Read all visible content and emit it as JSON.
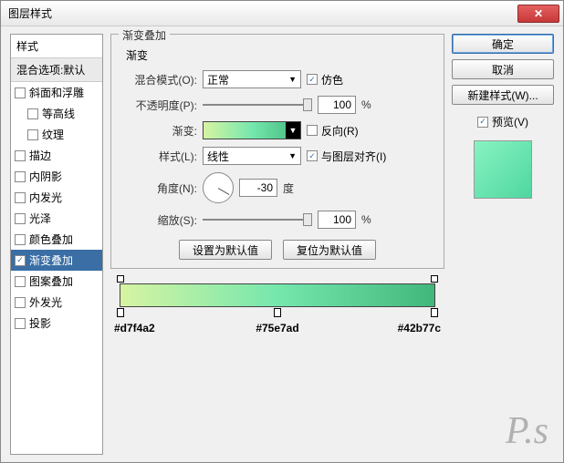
{
  "window": {
    "title": "图层样式"
  },
  "styles": {
    "header": "样式",
    "sub": "混合选项:默认",
    "items": [
      {
        "label": "斜面和浮雕",
        "checked": false,
        "indent": false,
        "selected": false
      },
      {
        "label": "等高线",
        "checked": false,
        "indent": true,
        "selected": false
      },
      {
        "label": "纹理",
        "checked": false,
        "indent": true,
        "selected": false
      },
      {
        "label": "描边",
        "checked": false,
        "indent": false,
        "selected": false
      },
      {
        "label": "内阴影",
        "checked": false,
        "indent": false,
        "selected": false
      },
      {
        "label": "内发光",
        "checked": false,
        "indent": false,
        "selected": false
      },
      {
        "label": "光泽",
        "checked": false,
        "indent": false,
        "selected": false
      },
      {
        "label": "颜色叠加",
        "checked": false,
        "indent": false,
        "selected": false
      },
      {
        "label": "渐变叠加",
        "checked": true,
        "indent": false,
        "selected": true
      },
      {
        "label": "图案叠加",
        "checked": false,
        "indent": false,
        "selected": false
      },
      {
        "label": "外发光",
        "checked": false,
        "indent": false,
        "selected": false
      },
      {
        "label": "投影",
        "checked": false,
        "indent": false,
        "selected": false
      }
    ]
  },
  "main": {
    "groupTitle": "渐变叠加",
    "subTitle": "渐变",
    "blendMode": {
      "label": "混合模式(O):",
      "value": "正常"
    },
    "dither": {
      "label": "仿色",
      "checked": true
    },
    "opacity": {
      "label": "不透明度(P):",
      "value": "100",
      "unit": "%"
    },
    "gradient": {
      "label": "渐变:"
    },
    "reverse": {
      "label": "反向(R)",
      "checked": false
    },
    "style": {
      "label": "样式(L):",
      "value": "线性"
    },
    "align": {
      "label": "与图层对齐(I)",
      "checked": true
    },
    "angle": {
      "label": "角度(N):",
      "value": "-30",
      "unit": "度"
    },
    "scale": {
      "label": "缩放(S):",
      "value": "100",
      "unit": "%"
    },
    "resetBtn": "设置为默认值",
    "restoreBtn": "复位为默认值"
  },
  "gradStops": {
    "c1": "#d7f4a2",
    "c2": "#75e7ad",
    "c3": "#42b77c"
  },
  "buttons": {
    "ok": "确定",
    "cancel": "取消",
    "newStyle": "新建样式(W)...",
    "preview": "预览(V)"
  }
}
